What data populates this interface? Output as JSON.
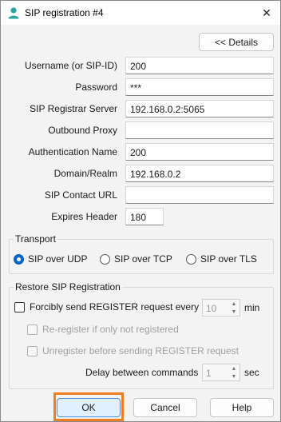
{
  "window": {
    "title": "SIP registration #4",
    "app_icon": "user-icon",
    "close_glyph": "✕"
  },
  "details_button": "<< Details",
  "fields": [
    {
      "label": "Username (or SIP-ID)",
      "value": "200"
    },
    {
      "label": "Password",
      "value": "***"
    },
    {
      "label": "SIP Registrar Server",
      "value": "192.168.0.2:5065"
    },
    {
      "label": "Outbound Proxy",
      "value": ""
    },
    {
      "label": "Authentication Name",
      "value": "200"
    },
    {
      "label": "Domain/Realm",
      "value": "192.168.0.2"
    },
    {
      "label": "SIP Contact URL",
      "value": ""
    }
  ],
  "expires": {
    "label": "Expires Header",
    "value": "180"
  },
  "transport": {
    "title": "Transport",
    "options": [
      "SIP over UDP",
      "SIP over TCP",
      "SIP over TLS"
    ],
    "selected": "SIP over UDP"
  },
  "restore": {
    "title": "Restore SIP Registration",
    "force_label": "Forcibly send REGISTER request every",
    "force_value": "10",
    "force_unit": "min",
    "reregister_label": "Re-register if only not registered",
    "unregister_label": "Unregister before sending REGISTER request",
    "delay_label": "Delay between commands",
    "delay_value": "1",
    "delay_unit": "sec"
  },
  "buttons": {
    "ok": "OK",
    "cancel": "Cancel",
    "help": "Help"
  }
}
